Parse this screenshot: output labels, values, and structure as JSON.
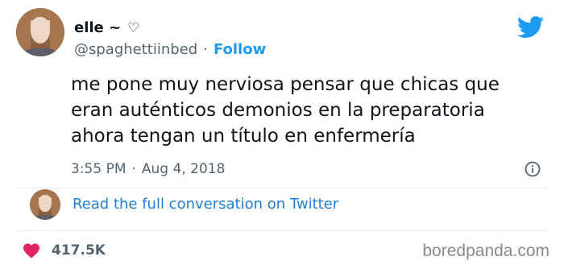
{
  "author": {
    "display_name": "elle ~",
    "name_heart_icon": "heart-outline-icon",
    "handle": "@spaghettiinbed",
    "separator": "·",
    "follow_label": "Follow"
  },
  "tweet": {
    "lines": [
      "me pone muy nerviosa pensar que chicas que",
      "eran auténticos demonios en la preparatoria",
      "ahora tengan un título en enfermería"
    ],
    "time": "3:55 PM",
    "meta_separator": "·",
    "date": "Aug 4, 2018"
  },
  "conversation": {
    "link_label": "Read the full conversation on Twitter"
  },
  "stats": {
    "likes": "417.5K"
  },
  "watermark": "boredpanda.com",
  "colors": {
    "accent": "#1d9bf0",
    "link": "#1d7ed8",
    "like": "#e0245e",
    "muted": "#536471"
  }
}
